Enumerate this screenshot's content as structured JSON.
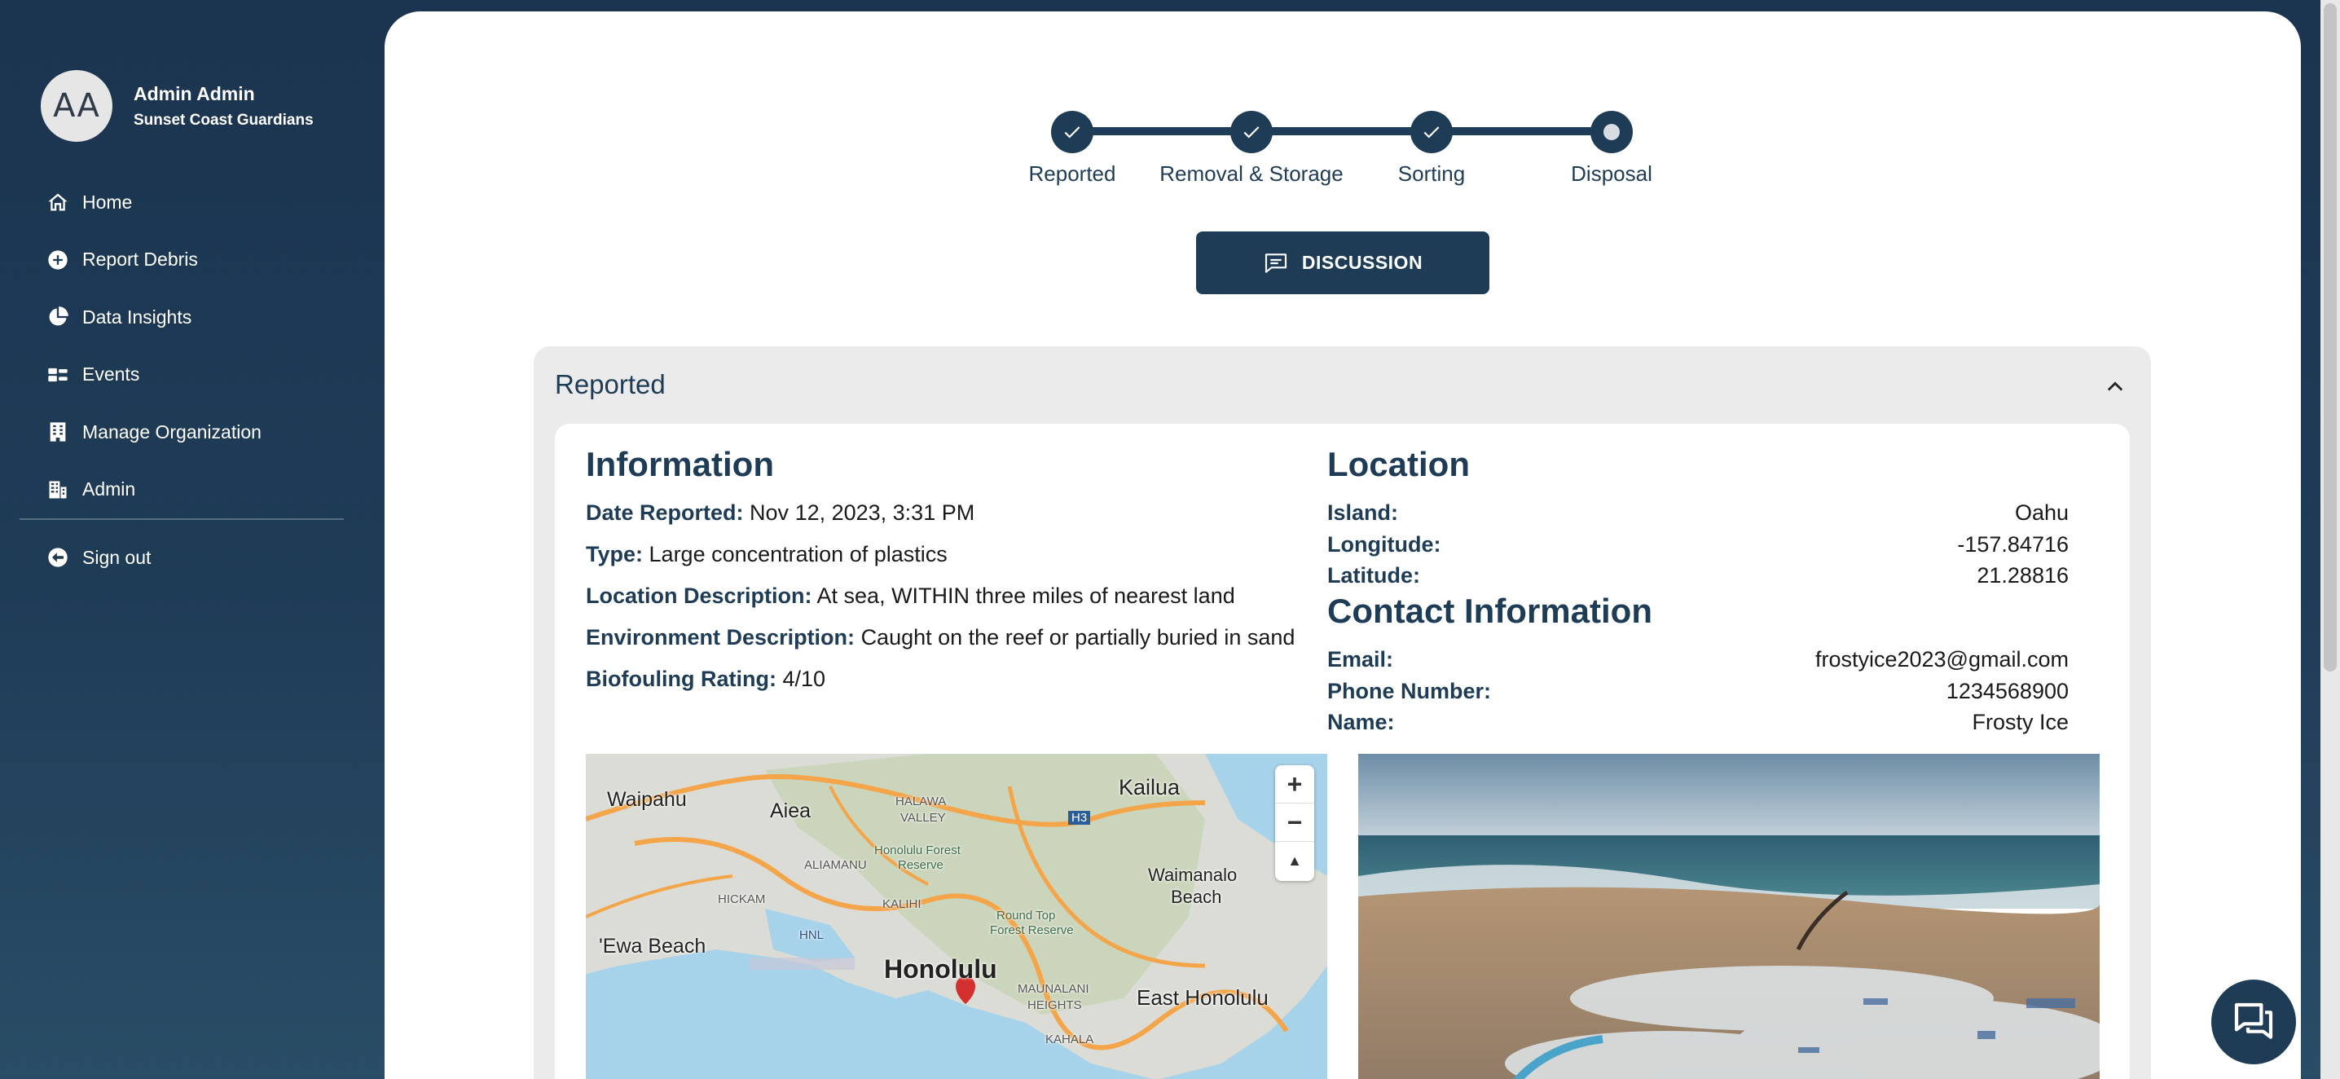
{
  "profile": {
    "initials": "AA",
    "name": "Admin Admin",
    "org": "Sunset Coast Guardians"
  },
  "nav": {
    "items": [
      {
        "label": "Home",
        "icon": "home-icon"
      },
      {
        "label": "Report Debris",
        "icon": "plus-circle-icon"
      },
      {
        "label": "Data Insights",
        "icon": "pie-chart-icon"
      },
      {
        "label": "Events",
        "icon": "events-icon"
      },
      {
        "label": "Manage Organization",
        "icon": "building-icon"
      },
      {
        "label": "Admin",
        "icon": "admin-icon"
      }
    ],
    "signout": {
      "label": "Sign out",
      "icon": "arrow-left-circle-icon"
    }
  },
  "stepper": {
    "steps": [
      {
        "label": "Reported",
        "state": "complete"
      },
      {
        "label": "Removal & Storage",
        "state": "complete"
      },
      {
        "label": "Sorting",
        "state": "complete"
      },
      {
        "label": "Disposal",
        "state": "current"
      }
    ]
  },
  "discussion_label": "DISCUSSION",
  "accordion": {
    "title": "Reported"
  },
  "information": {
    "title": "Information",
    "date": {
      "label": "Date Reported:",
      "value": "Nov 12, 2023, 3:31 PM"
    },
    "type": {
      "label": "Type:",
      "value": "Large concentration of plastics"
    },
    "location_desc": {
      "label": "Location Description:",
      "value": "At sea, WITHIN three miles of nearest land"
    },
    "environment_desc": {
      "label": "Environment Description:",
      "value": "Caught on the reef or partially buried in sand"
    },
    "biofouling": {
      "label": "Biofouling Rating:",
      "value": "4/10"
    }
  },
  "location": {
    "title": "Location",
    "island": {
      "label": "Island:",
      "value": "Oahu"
    },
    "longitude": {
      "label": "Longitude:",
      "value": "-157.84716"
    },
    "latitude": {
      "label": "Latitude:",
      "value": "21.28816"
    }
  },
  "contact": {
    "title": "Contact Information",
    "email": {
      "label": "Email:",
      "value": "frostyice2023@gmail.com"
    },
    "phone": {
      "label": "Phone Number:",
      "value": "1234568900"
    },
    "name": {
      "label": "Name:",
      "value": "Frosty Ice"
    }
  },
  "map": {
    "labels": {
      "waipahu": "Waipahu",
      "aiea": "Aiea",
      "kailua": "Kailua",
      "halawa": "HALAWA",
      "valley": "VALLEY",
      "honolulu_forest": "Honolulu Forest",
      "reserve": "Reserve",
      "aliamanu": "ALIAMANU",
      "hickam": "HICKAM",
      "kalihi": "KALIHI",
      "waimanalo": "Waimanalo",
      "beach": "Beach",
      "round_top": "Round Top",
      "forest_reserve": "Forest Reserve",
      "hnl": "HNL",
      "ewa_beach": "'Ewa Beach",
      "honolulu": "Honolulu",
      "maunalani": "MAUNALANI",
      "heights": "HEIGHTS",
      "east_honolulu": "East Honolulu",
      "kahala": "KAHALA",
      "h3": "H3"
    },
    "zoom_in": "+",
    "zoom_out": "−",
    "reset": "▲"
  },
  "colors": {
    "primary": "#1f3c57",
    "sidebar_bg": "#1b3450",
    "panel_bg": "#ebebeb"
  }
}
